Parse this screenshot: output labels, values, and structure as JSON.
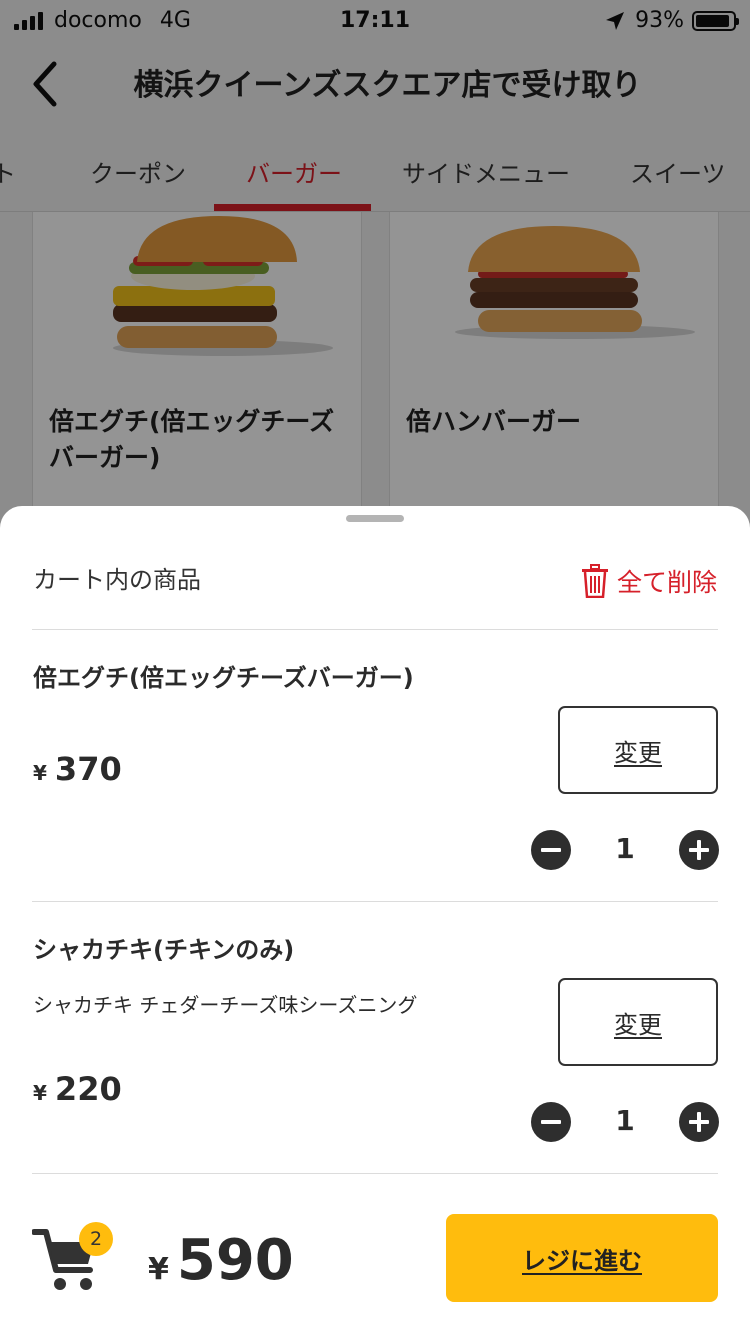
{
  "status_bar": {
    "carrier": "docomo",
    "network": "4G",
    "time": "17:11",
    "battery": "93%",
    "battery_level": 0.93
  },
  "header": {
    "title": "横浜クイーンズスクエア店で受け取り"
  },
  "tabs": [
    {
      "label": "ト"
    },
    {
      "label": "クーポン"
    },
    {
      "label": "バーガー",
      "active": true
    },
    {
      "label": "サイドメニュー"
    },
    {
      "label": "スイーツ"
    }
  ],
  "products": [
    {
      "name": "倍エグチ(倍エッグチーズバーガー)"
    },
    {
      "name": "倍ハンバーガー"
    }
  ],
  "cart": {
    "title": "カート内の商品",
    "delete_all_label": "全て削除",
    "change_label": "変更",
    "currency": "¥",
    "items": [
      {
        "name": "倍エグチ(倍エッグチーズバーガー)",
        "option": "",
        "price": "370",
        "quantity": "1"
      },
      {
        "name": "シャカチキ(チキンのみ)",
        "option": "シャカチキ チェダーチーズ味シーズニング",
        "price": "220",
        "quantity": "1"
      }
    ],
    "badge_count": "2",
    "total": "590",
    "checkout_label": "レジに進む"
  },
  "colors": {
    "accent_red": "#d6202a",
    "checkout_yellow": "#ffbc0d",
    "dark_button": "#2e2e2e"
  }
}
